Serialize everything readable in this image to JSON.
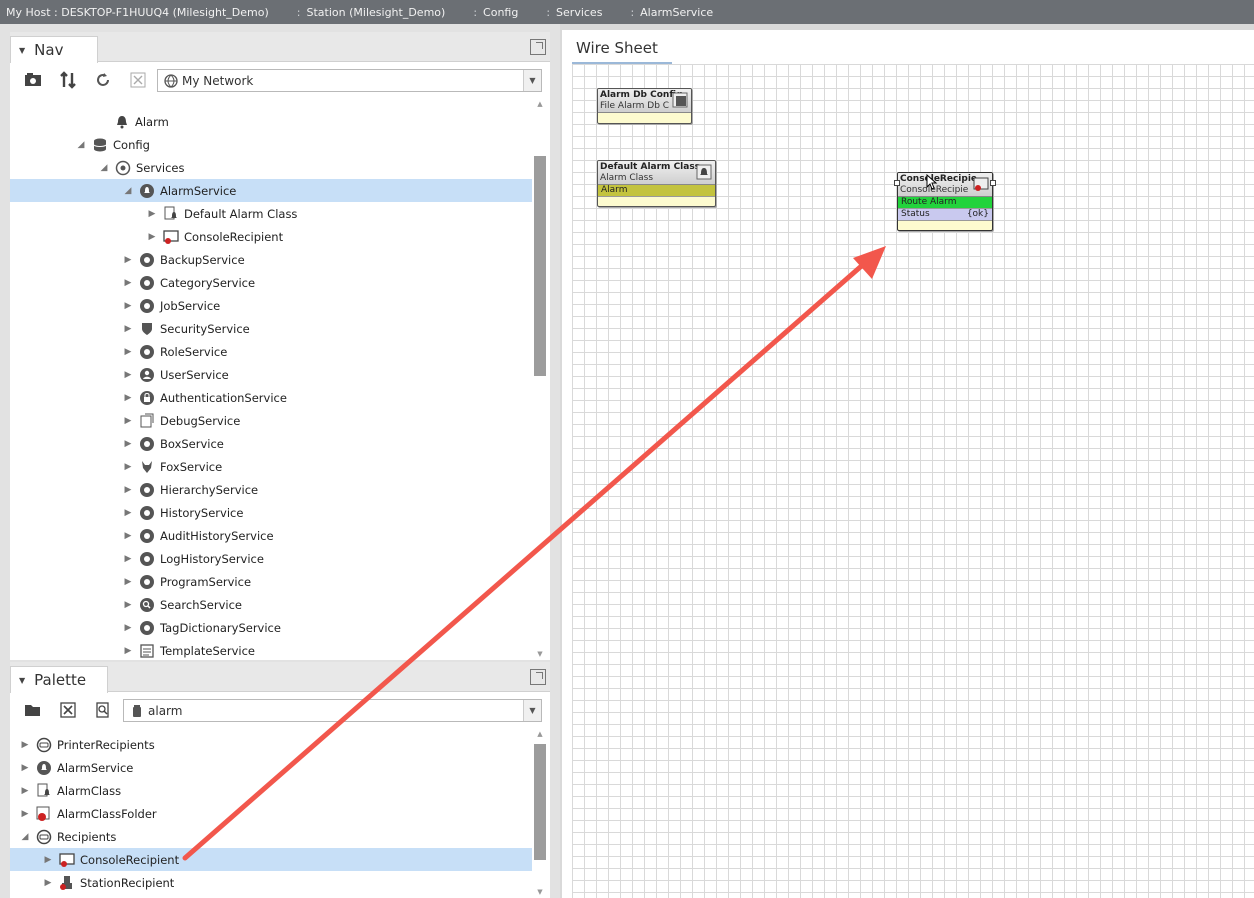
{
  "breadcrumb": [
    "My Host : DESKTOP-F1HUUQ4 (Milesight_Demo)",
    "Station (Milesight_Demo)",
    "Config",
    "Services",
    "AlarmService"
  ],
  "nav": {
    "title": "Nav",
    "network_value": "My Network",
    "items": [
      {
        "label": "Alarm",
        "icon": "bell-icon"
      },
      {
        "label": "Config",
        "icon": "database-icon"
      },
      {
        "label": "Services",
        "icon": "services-icon"
      },
      {
        "label": "AlarmService",
        "icon": "alarm-service-icon"
      },
      {
        "label": "Default Alarm Class",
        "icon": "alarm-class-icon"
      },
      {
        "label": "ConsoleRecipient",
        "icon": "console-recipient-icon"
      },
      {
        "label": "BackupService",
        "icon": "backup-icon"
      },
      {
        "label": "CategoryService",
        "icon": "category-icon"
      },
      {
        "label": "JobService",
        "icon": "job-icon"
      },
      {
        "label": "SecurityService",
        "icon": "shield-icon"
      },
      {
        "label": "RoleService",
        "icon": "role-icon"
      },
      {
        "label": "UserService",
        "icon": "user-icon"
      },
      {
        "label": "AuthenticationService",
        "icon": "lock-icon"
      },
      {
        "label": "DebugService",
        "icon": "debug-icon"
      },
      {
        "label": "BoxService",
        "icon": "box-icon"
      },
      {
        "label": "FoxService",
        "icon": "fox-icon"
      },
      {
        "label": "HierarchyService",
        "icon": "hierarchy-icon"
      },
      {
        "label": "HistoryService",
        "icon": "history-icon"
      },
      {
        "label": "AuditHistoryService",
        "icon": "audit-icon"
      },
      {
        "label": "LogHistoryService",
        "icon": "log-icon"
      },
      {
        "label": "ProgramService",
        "icon": "program-icon"
      },
      {
        "label": "SearchService",
        "icon": "search-icon"
      },
      {
        "label": "TagDictionaryService",
        "icon": "tag-icon"
      },
      {
        "label": "TemplateService",
        "icon": "template-icon"
      }
    ]
  },
  "palette": {
    "title": "Palette",
    "search_value": "alarm",
    "items": [
      {
        "label": "PrinterRecipients",
        "icon": "folder-icon"
      },
      {
        "label": "AlarmService",
        "icon": "alarm-service-icon"
      },
      {
        "label": "AlarmClass",
        "icon": "alarm-class-icon"
      },
      {
        "label": "AlarmClassFolder",
        "icon": "alarm-class-folder-icon"
      },
      {
        "label": "Recipients",
        "icon": "folder-icon"
      },
      {
        "label": "ConsoleRecipient",
        "icon": "console-recipient-icon"
      },
      {
        "label": "StationRecipient",
        "icon": "station-recipient-icon"
      }
    ]
  },
  "wiresheet": {
    "tab": "Wire Sheet",
    "components": [
      {
        "title": "Alarm Db Config",
        "type": "File Alarm Db C",
        "slots": []
      },
      {
        "title": "Default Alarm Class",
        "type": "Alarm Class",
        "slots": [
          {
            "name": "Alarm",
            "value": ""
          }
        ]
      },
      {
        "title": "ConsoleRecipie",
        "type": "ConsoleRecipie",
        "slots": [
          {
            "name": "Route Alarm",
            "value": ""
          },
          {
            "name": "Status",
            "value": "{ok}"
          }
        ]
      }
    ]
  },
  "colors": {
    "selection": "#c7dff7",
    "annotation_arrow": "#f2574c",
    "route_alarm_slot": "#22d33c",
    "alarm_slot": "#c3c33e",
    "status_slot": "#c9c9ef"
  }
}
